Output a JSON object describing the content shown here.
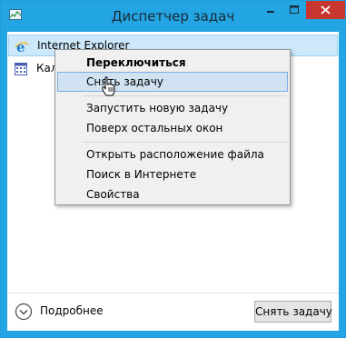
{
  "window": {
    "title": "Диспетчер задач"
  },
  "processes": [
    {
      "label": "Internet Explorer",
      "icon": "internet-explorer-icon",
      "selected": true
    },
    {
      "label": "Кал",
      "icon": "calendar-icon",
      "selected": false
    }
  ],
  "context_menu": {
    "items": [
      {
        "label": "Переключиться",
        "bold": true
      },
      {
        "label": "Снять задачу",
        "hover": true
      },
      {
        "label": "Запустить новую задачу"
      },
      {
        "label": "Поверх остальных окон"
      },
      {
        "label": "Открыть расположение файла"
      },
      {
        "label": "Поиск в Интернете"
      },
      {
        "label": "Свойства"
      }
    ]
  },
  "footer": {
    "details_label": "Подробнее",
    "end_task_label": "Снять задачу"
  },
  "colors": {
    "title_bar": "#23a4e3",
    "close_button": "#c7372f",
    "selection": "#cde8fb",
    "menu_hover": "#d1e2f2"
  }
}
